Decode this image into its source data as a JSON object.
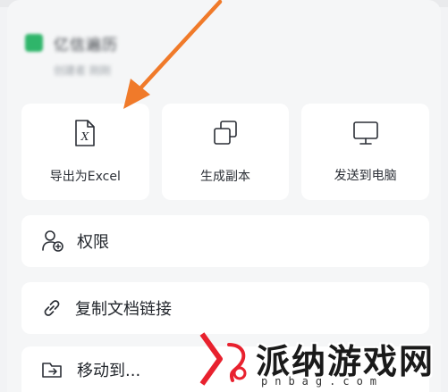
{
  "file": {
    "name": "亿信遍历",
    "meta": "创建者 刚刚"
  },
  "actions": [
    {
      "label": "导出为Excel",
      "icon": "excel-file-icon"
    },
    {
      "label": "生成副本",
      "icon": "duplicate-icon"
    },
    {
      "label": "发送到电脑",
      "icon": "monitor-icon"
    }
  ],
  "menu": [
    {
      "label": "权限",
      "icon": "user-add-icon"
    },
    {
      "label": "复制文档链接",
      "icon": "link-icon"
    },
    {
      "label": "移动到...",
      "icon": "folder-move-icon"
    }
  ],
  "colors": {
    "arrow": "#f07a2a",
    "sheet_icon": "#2fb56a",
    "watermark_accent": "#e8212e"
  },
  "watermark": {
    "text": "派纳游戏网",
    "url": "pnbag.com"
  }
}
